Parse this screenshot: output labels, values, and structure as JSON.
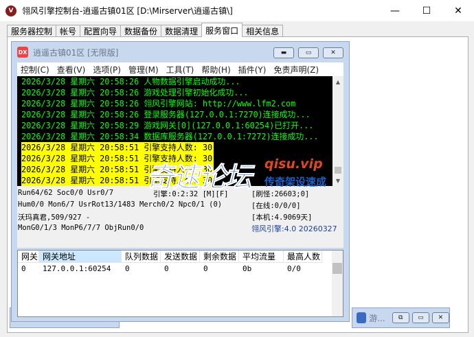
{
  "window": {
    "title": "翎风引擎控制台-逍遥古镇01区 [D:\\Mirserver\\逍遥古镇\\]",
    "minimize": "—",
    "maximize": "☐",
    "close": "✕"
  },
  "tabs": [
    {
      "label": "服务器控制"
    },
    {
      "label": "帐号"
    },
    {
      "label": "配置向导"
    },
    {
      "label": "数据备份"
    },
    {
      "label": "数据清理"
    },
    {
      "label": "服务窗口"
    },
    {
      "label": "相关信息"
    }
  ],
  "active_tab": "服务窗口",
  "mdi": {
    "icon_text": "DX",
    "title": "逍遥古镇01区 [无限版]",
    "menu": [
      {
        "label": "控制(C)"
      },
      {
        "label": "查看(V)"
      },
      {
        "label": "选项(P)"
      },
      {
        "label": "管理(M)"
      },
      {
        "label": "工具(T)"
      },
      {
        "label": "帮助(H)"
      },
      {
        "label": "插件(Y)"
      },
      {
        "label": "免责声明(Z)"
      }
    ]
  },
  "log": [
    {
      "text": "2026/3/28 星期六 20:58:26 人物数据引擎启动成功...",
      "style": "green"
    },
    {
      "text": "2026/3/28 星期六 20:58:26 游戏处理引擎初始化成功...",
      "style": "green"
    },
    {
      "text": "2026/3/28 星期六 20:58:26 翎风引擎网站: http://www.lfm2.com",
      "style": "green"
    },
    {
      "text": "2026/3/28 星期六 20:58:26 登录服务器(127.0.0.1:7270)连接成功...",
      "style": "green"
    },
    {
      "text": "2026/3/28 星期六 20:58:29 游戏网关[0](127.0.0.1:60254)已打开...",
      "style": "green"
    },
    {
      "text": "2026/3/28 星期六 20:58:34 数据库服务器(127.0.0.1:7272)连接成功...",
      "style": "green"
    },
    {
      "text": "2026/3/28 星期六 20:58:51 引擎支持人数: 30",
      "style": "hl"
    },
    {
      "text": "2026/3/28 星期六 20:58:51 引擎支持人数: 30",
      "style": "hl"
    },
    {
      "text": "2026/3/28 星期六 20:58:51 引擎支持人数: 30",
      "style": "hl"
    },
    {
      "text": "2026/3/28 星期六 20:58:51 引擎支持人数: 30",
      "style": "hl"
    }
  ],
  "watermark": {
    "big": "奇速论坛",
    "url": "qisu.vip",
    "sub": "传奇架设速成"
  },
  "status": {
    "line1_left": "Run64/62 Soc0/0 Usr0/7",
    "line1_mid": "引擎:0:2:32 [M][F]",
    "line1_right": "[刷怪:26603;0]",
    "line2_left": "Hum0/0 Mon6/7 UsrRot13/1483 Merch0/2 Npc0/1 (0)",
    "line2_right": "[在线:0/0/0]",
    "line3_left": "沃玛真君,509/927 -",
    "line3_right": "[本机:4.9069天]",
    "line4_left": "MonG0/1/3 MonP6/7/7 ObjRun0/0",
    "line4_right": "翎风引擎:4.0 20260327"
  },
  "gateway": {
    "columns": [
      "网关",
      "网关地址",
      "队列数据",
      "发送数据",
      "剩余数据",
      "平均流量",
      "最高人数"
    ],
    "rows": [
      [
        "0",
        "127.0.0.1:60254",
        "0",
        "0",
        "0",
        "0b",
        "0/0"
      ]
    ]
  },
  "minimized": [
    {
      "label": ""
    },
    {
      "label": "游..."
    }
  ]
}
